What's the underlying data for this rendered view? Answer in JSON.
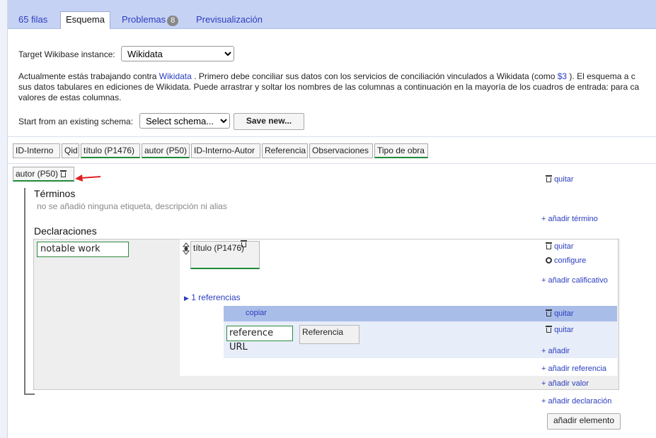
{
  "tabs": [
    {
      "label": "65 filas"
    },
    {
      "label": "Esquema"
    },
    {
      "label": "Problemas",
      "badge": "8"
    },
    {
      "label": "Previsualización"
    }
  ],
  "instance": {
    "label": "Target Wikibase instance:",
    "selected": "Wikidata"
  },
  "intro": {
    "part1": "Actualmente estás trabajando contra ",
    "link1": "Wikidata",
    "part2": " . Primero debe conciliar sus datos con los servicios de conciliación vinculados a Wikidata (como ",
    "link2": "$3",
    "part3": " ). El esquema a c",
    "line2": "sus datos tabulares en ediciones de Wikidata. Puede arrastrar y soltar los nombres de las columnas a continuación en la mayoría de los cuadros de entrada: para ca",
    "line3": "valores de estas columnas."
  },
  "schema": {
    "label": "Start from an existing schema:",
    "selected": "Select schema...",
    "save_label": "Save new..."
  },
  "columns": [
    "ID-Interno",
    "Qid",
    "título (P1476)",
    "autor (P50)",
    "ID-Interno-Autor",
    "Referencia",
    "Observaciones",
    "Tipo de obra"
  ],
  "item": {
    "subject": "autor (P50)",
    "remove": "quitar",
    "terms_title": "Términos",
    "terms_empty": "no se añadió ninguna etiqueta, descripción ni alias",
    "add_term": "+ añadir término",
    "statements_title": "Declaraciones",
    "statement": {
      "property": "notable work",
      "value": "título (P1476)",
      "remove": "quitar",
      "configure": "configure",
      "add_qualifier": "+ añadir calificativo",
      "references_toggle": "1 referencias",
      "reference": {
        "copy": "copiar",
        "remove": "quitar",
        "property": "reference URL",
        "value": "Referencia",
        "inner_remove": "quitar",
        "add": "+ añadir"
      },
      "add_reference": "+ añadir referencia",
      "add_value": "+ añadir valor"
    },
    "add_statement": "+ añadir declaración"
  },
  "add_item": "añadir elemento",
  "colors": {
    "tab_bar": "#c6d2f4",
    "link": "#2b3dbf",
    "matched": "#1f8a3a",
    "ref_header": "#a9bde9",
    "arrow": "#e02020"
  }
}
